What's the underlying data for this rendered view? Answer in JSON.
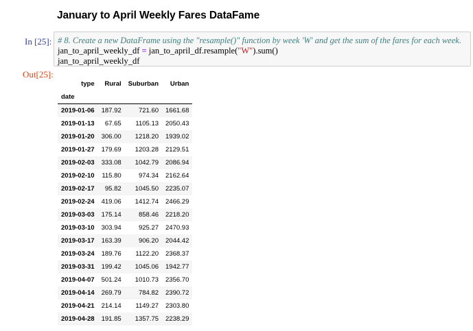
{
  "heading": "January to April Weekly Fares DataFame",
  "input_prompt": "In [25]:",
  "output_prompt": "Out[25]:",
  "code": {
    "comment": "# 8. Create a new DataFrame using the \"resample()\" function by week 'W' and get the sum of the fares for each week.",
    "line2_a": "jan_to_april_weekly_df ",
    "line2_op": "=",
    "line2_b": " jan_to_april_df.resample(",
    "line2_str": "\"W\"",
    "line2_c": ").sum()",
    "line3": "jan_to_april_weekly_df"
  },
  "table": {
    "columns_name": "type",
    "columns": [
      "Rural",
      "Suburban",
      "Urban"
    ],
    "index_name": "date",
    "rows": [
      {
        "date": "2019-01-06",
        "values": [
          "187.92",
          "721.60",
          "1661.68"
        ]
      },
      {
        "date": "2019-01-13",
        "values": [
          "67.65",
          "1105.13",
          "2050.43"
        ]
      },
      {
        "date": "2019-01-20",
        "values": [
          "306.00",
          "1218.20",
          "1939.02"
        ]
      },
      {
        "date": "2019-01-27",
        "values": [
          "179.69",
          "1203.28",
          "2129.51"
        ]
      },
      {
        "date": "2019-02-03",
        "values": [
          "333.08",
          "1042.79",
          "2086.94"
        ]
      },
      {
        "date": "2019-02-10",
        "values": [
          "115.80",
          "974.34",
          "2162.64"
        ]
      },
      {
        "date": "2019-02-17",
        "values": [
          "95.82",
          "1045.50",
          "2235.07"
        ]
      },
      {
        "date": "2019-02-24",
        "values": [
          "419.06",
          "1412.74",
          "2466.29"
        ]
      },
      {
        "date": "2019-03-03",
        "values": [
          "175.14",
          "858.46",
          "2218.20"
        ]
      },
      {
        "date": "2019-03-10",
        "values": [
          "303.94",
          "925.27",
          "2470.93"
        ]
      },
      {
        "date": "2019-03-17",
        "values": [
          "163.39",
          "906.20",
          "2044.42"
        ]
      },
      {
        "date": "2019-03-24",
        "values": [
          "189.76",
          "1122.20",
          "2368.37"
        ]
      },
      {
        "date": "2019-03-31",
        "values": [
          "199.42",
          "1045.06",
          "1942.77"
        ]
      },
      {
        "date": "2019-04-07",
        "values": [
          "501.24",
          "1010.73",
          "2356.70"
        ]
      },
      {
        "date": "2019-04-14",
        "values": [
          "269.79",
          "784.82",
          "2390.72"
        ]
      },
      {
        "date": "2019-04-21",
        "values": [
          "214.14",
          "1149.27",
          "2303.80"
        ]
      },
      {
        "date": "2019-04-28",
        "values": [
          "191.85",
          "1357.75",
          "2238.29"
        ]
      }
    ]
  }
}
